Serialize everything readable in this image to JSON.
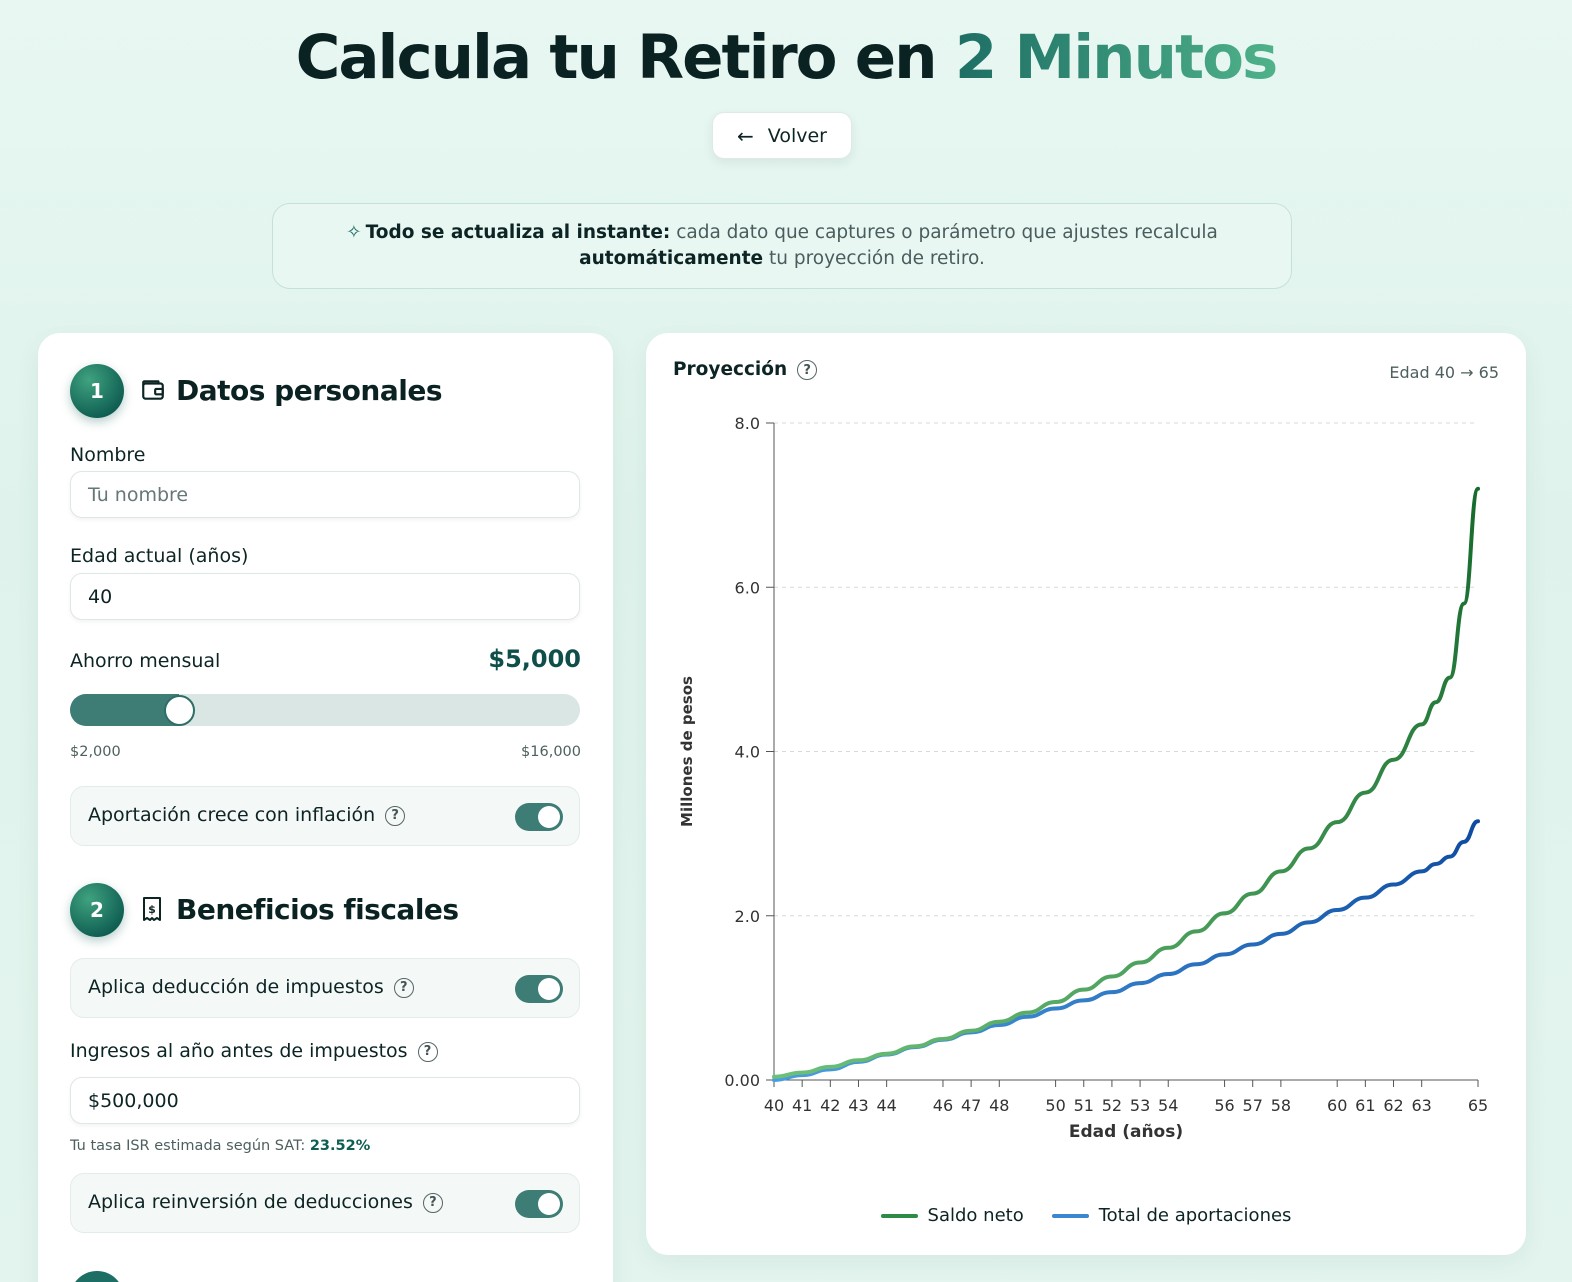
{
  "header": {
    "title_main": "Calcula tu Retiro en ",
    "title_accent": "2 Minutos",
    "back_label": "Volver"
  },
  "banner": {
    "bold_lead": "Todo se actualiza al instante:",
    "text_1": " cada dato que captures o parámetro que ajustes recalcula",
    "bold_mid": "automáticamente",
    "text_2": " tu proyección de retiro."
  },
  "personal": {
    "step": "1",
    "icon": "wallet-icon",
    "title": "Datos personales",
    "name_label": "Nombre",
    "name_placeholder": "Tu nombre",
    "name_value": "",
    "age_label": "Edad actual (años)",
    "age_value": "40",
    "saving_label": "Ahorro mensual",
    "saving_value": "$5,000",
    "slider_min_label": "$2,000",
    "slider_max_label": "$16,000",
    "slider_fraction": 0.2143,
    "inflation_label": "Aportación crece con inflación",
    "inflation_on": true
  },
  "fiscal": {
    "step": "2",
    "icon": "receipt-icon",
    "title": "Beneficios fiscales",
    "deduction_label": "Aplica deducción de impuestos",
    "deduction_on": true,
    "income_label": "Ingresos al año antes de impuestos",
    "income_value": "$500,000",
    "isr_text": "Tu tasa ISR estimada según SAT: ",
    "isr_value": "23.52%",
    "reinvest_label": "Aplica reinversión de deducciones",
    "reinvest_on": true
  },
  "projection": {
    "title": "Proyección",
    "range_label": "Edad 40 → 65"
  },
  "chart_data": {
    "type": "line",
    "xlabel": "Edad (años)",
    "ylabel": "Millones de pesos",
    "ylim": [
      0,
      8
    ],
    "xlim": [
      40,
      65
    ],
    "y_ticks": [
      "0.00",
      "2.0",
      "4.0",
      "6.0",
      "8.0"
    ],
    "y_tick_values": [
      0,
      2,
      4,
      6,
      8
    ],
    "x_ticks": [
      40,
      41,
      42,
      43,
      44,
      46,
      47,
      48,
      50,
      51,
      52,
      53,
      54,
      56,
      57,
      58,
      60,
      61,
      62,
      63,
      65
    ],
    "grid": "horizontal-dashed",
    "legend_position": "bottom",
    "x": [
      40,
      41,
      42,
      43,
      44,
      45,
      46,
      47,
      48,
      49,
      50,
      51,
      52,
      53,
      54,
      55,
      56,
      57,
      58,
      59,
      60,
      61,
      62,
      63,
      63.5,
      64,
      64.5,
      65
    ],
    "series": [
      {
        "name": "Saldo neto",
        "color": "#2e8b46",
        "color_end": "#156a2c",
        "values": [
          0.04,
          0.09,
          0.16,
          0.24,
          0.32,
          0.41,
          0.5,
          0.6,
          0.71,
          0.82,
          0.95,
          1.1,
          1.26,
          1.43,
          1.61,
          1.81,
          2.03,
          2.27,
          2.54,
          2.82,
          3.14,
          3.5,
          3.9,
          4.33,
          4.6,
          4.9,
          5.8,
          7.2
        ]
      },
      {
        "name": "Total de aportaciones",
        "color": "#3a86d0",
        "color_end": "#0d4aa0",
        "values": [
          0.0,
          0.06,
          0.13,
          0.22,
          0.31,
          0.4,
          0.49,
          0.58,
          0.67,
          0.77,
          0.87,
          0.97,
          1.07,
          1.18,
          1.29,
          1.41,
          1.53,
          1.65,
          1.78,
          1.92,
          2.07,
          2.22,
          2.38,
          2.54,
          2.63,
          2.72,
          2.9,
          3.15
        ]
      }
    ]
  }
}
